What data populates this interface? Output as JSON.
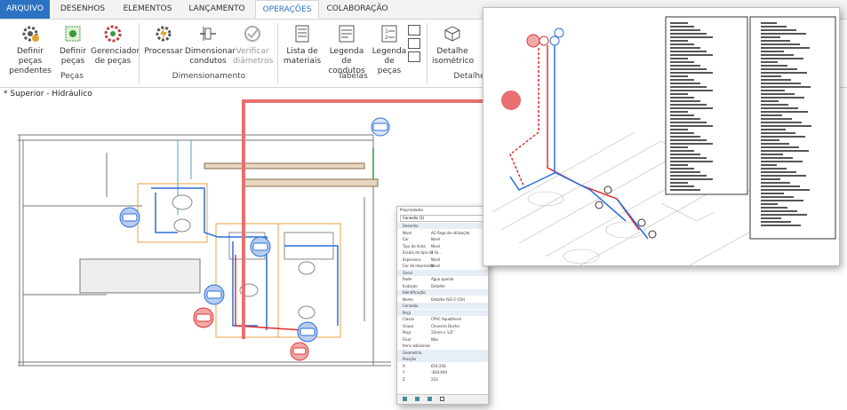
{
  "tabs": [
    {
      "label": "ARQUIVO"
    },
    {
      "label": "DESENHOS"
    },
    {
      "label": "ELEMENTOS"
    },
    {
      "label": "LANÇAMENTO"
    },
    {
      "label": "OPERAÇÕES"
    },
    {
      "label": "COLABORAÇÃO"
    }
  ],
  "ribbon": {
    "buttons": [
      {
        "line1": "Definir peças",
        "line2": "pendentes",
        "icon": "gear-icon"
      },
      {
        "line1": "Definir",
        "line2": "peças",
        "icon": "parts-icon"
      },
      {
        "line1": "Gerenciador",
        "line2": "de peças",
        "icon": "manager-icon"
      },
      {
        "line1": "Processar",
        "line2": "",
        "icon": "process-icon"
      },
      {
        "line1": "Dimensionar",
        "line2": "condutos",
        "icon": "dimension-icon"
      },
      {
        "line1": "Verificar",
        "line2": "diâmetros",
        "icon": "verify-icon"
      },
      {
        "line1": "Lista de",
        "line2": "materiais",
        "icon": "list-icon"
      },
      {
        "line1": "Legenda de",
        "line2": "condutos",
        "icon": "legend-icon"
      },
      {
        "line1": "Legenda",
        "line2": "de peças",
        "icon": "legend-parts-icon"
      },
      {
        "line1": "Detalhe",
        "line2": "isométrico",
        "icon": "isometric-icon"
      }
    ],
    "groups": [
      {
        "label": "Peças"
      },
      {
        "label": "Dimensionamento"
      },
      {
        "label": "Tabelas"
      },
      {
        "label": "Detalhe"
      }
    ]
  },
  "view": {
    "label": "* Superior - Hidráulico"
  },
  "properties": {
    "title": "Propriedades",
    "selector": "Conexão (1)",
    "rows": [
      {
        "k": "Desenho",
        "v": "",
        "sec": true
      },
      {
        "k": "Nível",
        "v": "AG Regs de utilização",
        "sec": false
      },
      {
        "k": "Cor",
        "v": "Nível",
        "sec": false
      },
      {
        "k": "Tipo de linha",
        "v": "Nível",
        "sec": false
      },
      {
        "k": "Escala do tipo de lin...",
        "v": "1",
        "sec": false
      },
      {
        "k": "Espessura",
        "v": "Nível",
        "sec": false
      },
      {
        "k": "Cor de impressão",
        "v": "Nível",
        "sec": false
      },
      {
        "k": "Geral",
        "v": "",
        "sec": true
      },
      {
        "k": "Rede",
        "v": "Água quente",
        "sec": false
      },
      {
        "k": "Exibição",
        "v": "Detalhe",
        "sec": false
      },
      {
        "k": "Identificação",
        "v": "",
        "sec": true
      },
      {
        "k": "Nome",
        "v": "Detalhe ISO-2 (CH)",
        "sec": false
      },
      {
        "k": "Conexão",
        "v": "",
        "sec": true
      },
      {
        "k": "Peça",
        "v": "",
        "sec": true
      },
      {
        "k": "Classe",
        "v": "CPVC Aquatherm",
        "sec": false
      },
      {
        "k": "Grupo",
        "v": "Chuveiro Ducha",
        "sec": false
      },
      {
        "k": "Peça",
        "v": "22mm x 1/2\"",
        "sec": false
      },
      {
        "k": "Fixar",
        "v": "Não",
        "sec": false
      },
      {
        "k": "Itens adicionais",
        "v": "",
        "sec": false
      },
      {
        "k": "Geometria",
        "v": "",
        "sec": true
      },
      {
        "k": "Posição",
        "v": "",
        "sec": true
      },
      {
        "k": "X",
        "v": "654,356",
        "sec": false
      },
      {
        "k": "Y",
        "v": "-830,640",
        "sec": false
      },
      {
        "k": "Z",
        "v": "210",
        "sec": false
      }
    ]
  },
  "colors": {
    "accent": "#2b73c2",
    "hot_water": "#e03030",
    "cold_water": "#2a6fdb",
    "highlight_box": "#e8a040",
    "callout": "#e87070"
  }
}
